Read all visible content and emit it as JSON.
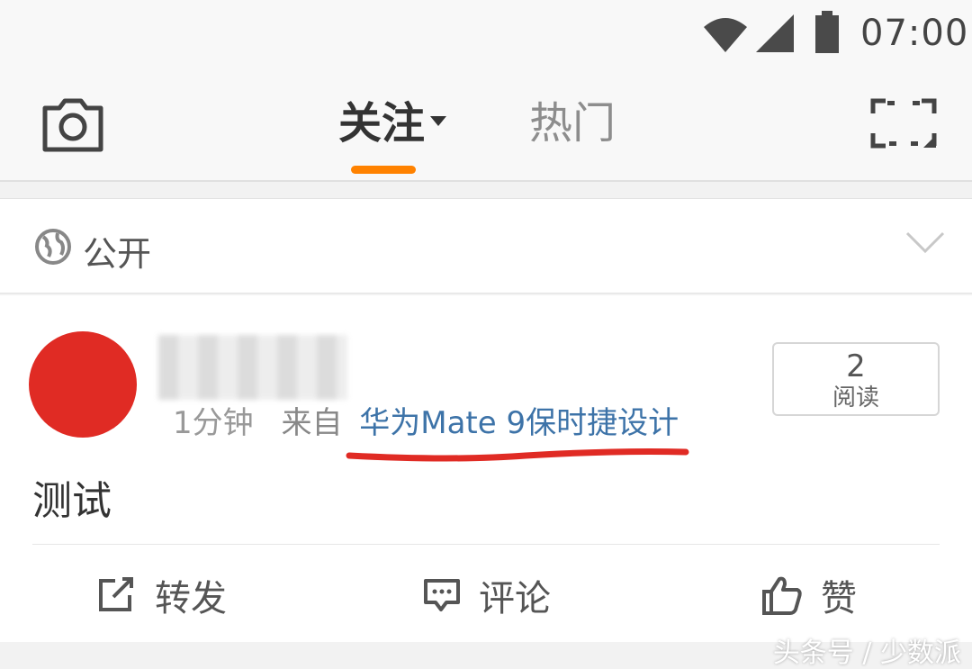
{
  "status_bar": {
    "time": "07:00",
    "icons": [
      "wifi-icon",
      "signal-icon",
      "battery-icon"
    ]
  },
  "nav": {
    "tabs": [
      {
        "label": "关注",
        "active": true,
        "has_dropdown": true
      },
      {
        "label": "热门",
        "active": false
      }
    ],
    "left_icon": "camera-icon",
    "right_icon": "scan-icon",
    "indicator_color": "#ff8200"
  },
  "visibility": {
    "label": "公开",
    "icon": "globe-icon"
  },
  "post": {
    "time": "1分钟",
    "from_label": "来自",
    "source": "华为Mate 9保时捷设计",
    "read_count": "2",
    "read_label": "阅读",
    "text": "测试"
  },
  "actions": {
    "repost": "转发",
    "comment": "评论",
    "like": "赞"
  },
  "watermark": "头条号 / 少数派",
  "colors": {
    "link": "#3d73a8",
    "avatar": "#e02b24",
    "underline": "#e02b24"
  }
}
